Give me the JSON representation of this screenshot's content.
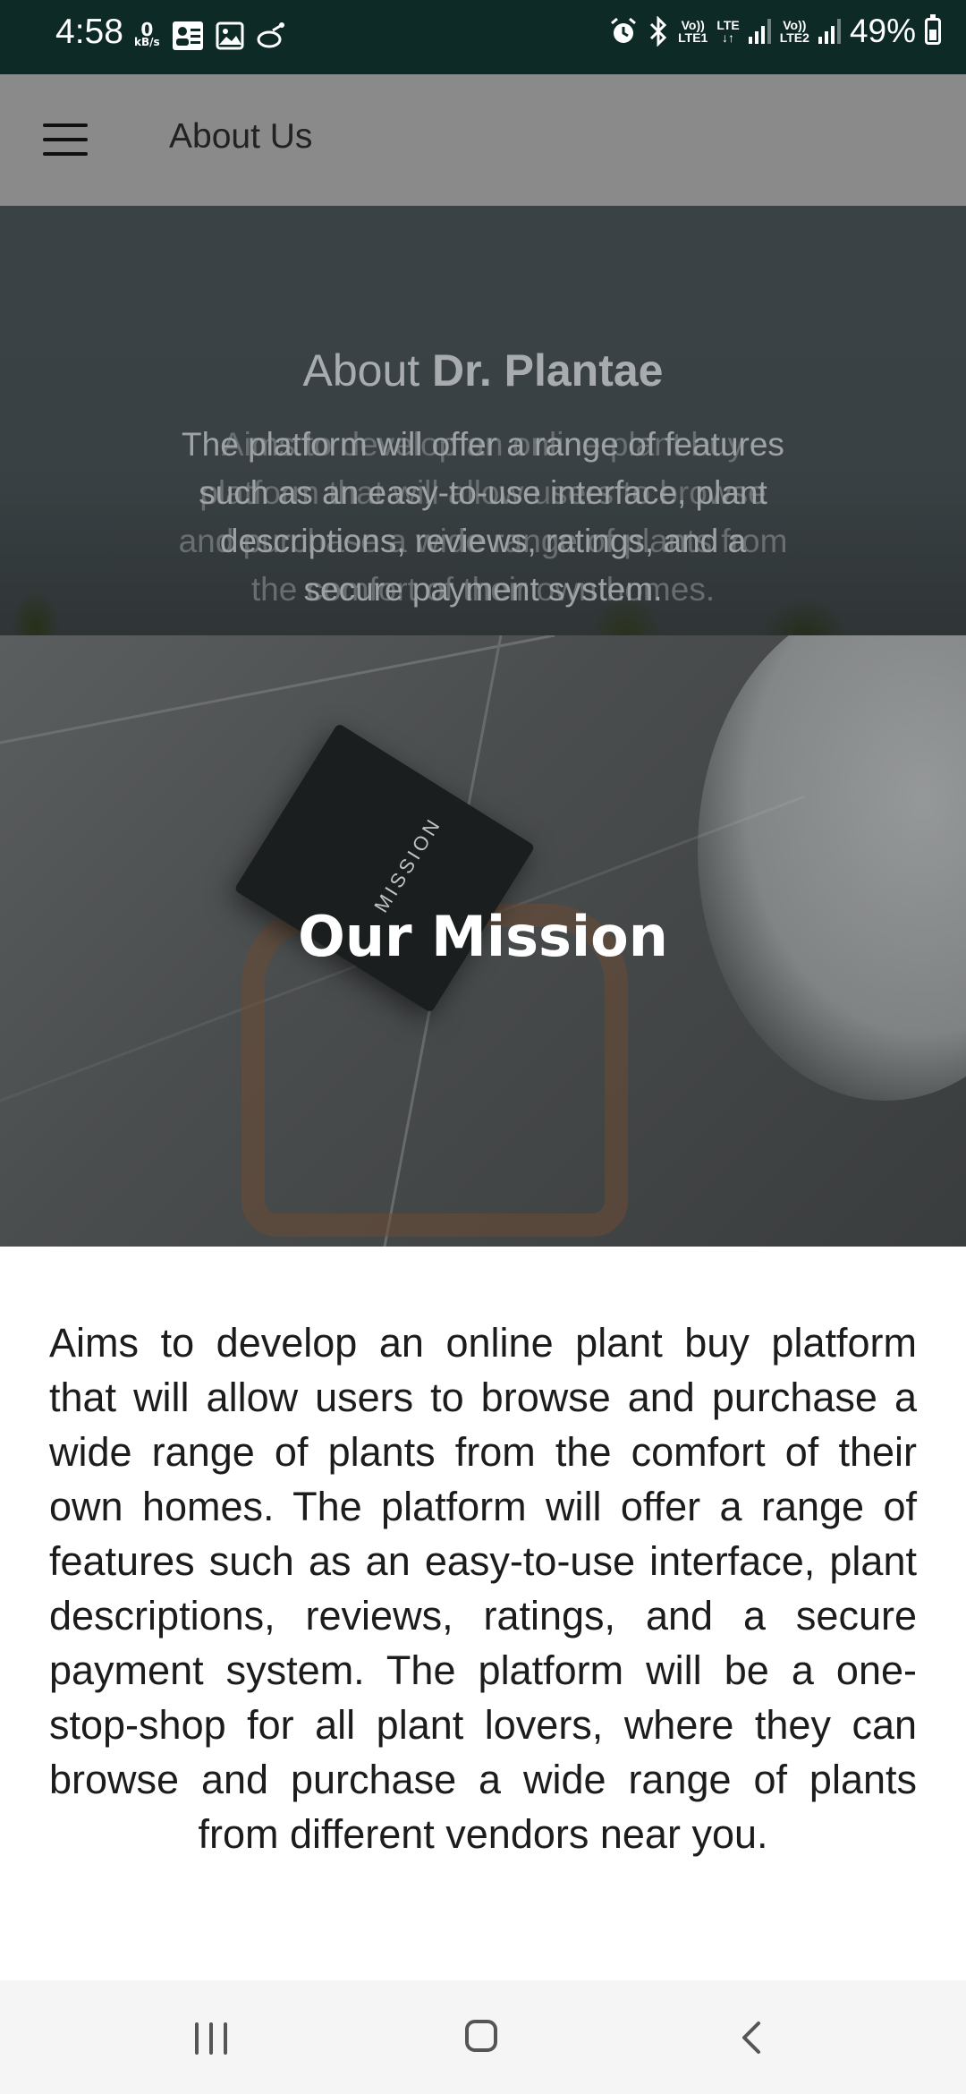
{
  "status_bar": {
    "time": "4:58",
    "data_rate_value": "0",
    "data_rate_unit": "kB/s",
    "sim1_top": "Vo))",
    "sim1_bottom": "LTE1",
    "sim1_net": "LTE",
    "sim2_top": "Vo))",
    "sim2_bottom": "LTE2",
    "battery": "49%",
    "battery_level": 0.49
  },
  "app_bar": {
    "title": "About Us"
  },
  "about": {
    "title_prefix": "About ",
    "title_brand": "Dr. Plantae",
    "text": "The platform will offer a range of features such as an easy-to-use interface, plant descriptions, reviews, ratings, and a secure payment system.",
    "ghost_text": "Aims to develop an online plant buy platform that will allow users to browse and purchase a wide range of plants from the comfort of their own homes."
  },
  "mission": {
    "title": "Our Mission",
    "journal_label": "MISSION",
    "text": "Aims to develop an online plant buy platform that will allow users to browse and purchase a wide range of plants from the comfort of their own homes. The platform will offer a range of features such as an easy-to-use interface, plant descriptions, reviews, ratings, and a secure payment system. The platform will be a one-stop-shop for all plant lovers, where they can browse and purchase a wide range of plants from different vendors near you."
  }
}
